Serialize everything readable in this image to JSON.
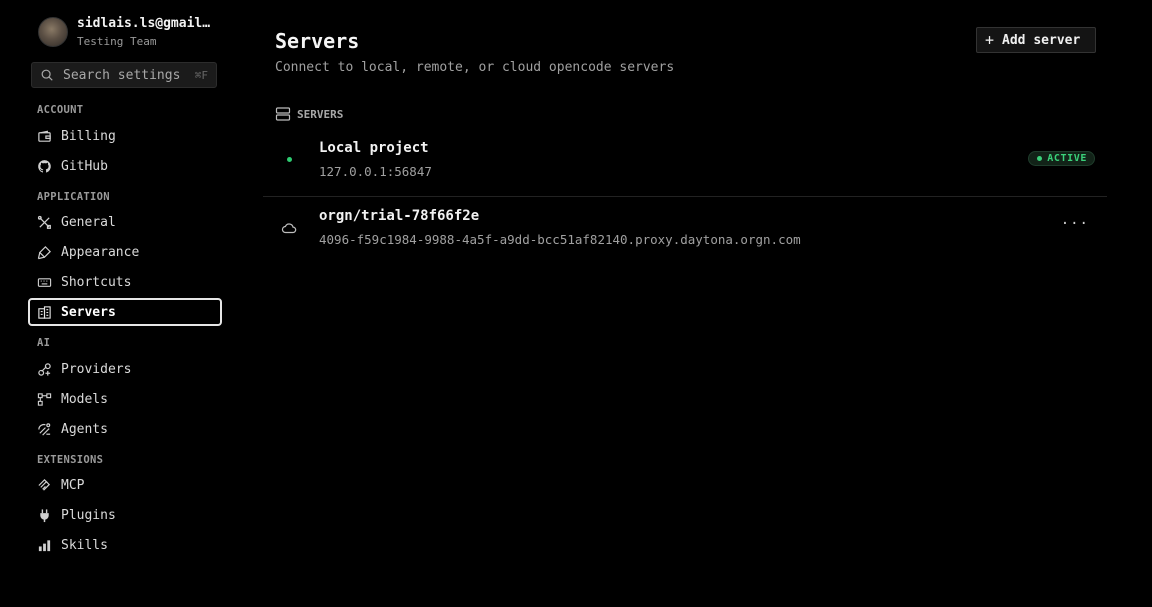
{
  "profile": {
    "email": "sidlais.ls@gmail.com",
    "team": "Testing Team"
  },
  "search": {
    "label": "Search settings",
    "shortcut": "⌘F"
  },
  "sections": {
    "account": "ACCOUNT",
    "application": "APPLICATION",
    "ai": "AI",
    "extensions": "EXTENSIONS"
  },
  "nav": {
    "billing": "Billing",
    "github": "GitHub",
    "general": "General",
    "appearance": "Appearance",
    "shortcuts": "Shortcuts",
    "servers": "Servers",
    "providers": "Providers",
    "models": "Models",
    "agents": "Agents",
    "mcp": "MCP",
    "plugins": "Plugins",
    "skills": "Skills"
  },
  "active_nav": "servers",
  "main": {
    "title": "Servers",
    "subtitle": "Connect to local, remote, or cloud opencode servers",
    "add_button": "Add server",
    "section_label": "SERVERS"
  },
  "servers": [
    {
      "name": "Local project",
      "url": "127.0.0.1:56847",
      "status": "ACTIVE",
      "icon": "green-dot-icon"
    },
    {
      "name": "orgn/trial-78f66f2e",
      "url": "4096-f59c1984-9988-4a5f-a9dd-bcc51af82140.proxy.daytona.orgn.com",
      "icon": "cloud-icon"
    }
  ],
  "colors": {
    "background": "#000000",
    "accent_green": "#3ad17a",
    "active_border": "#e6e6e6"
  }
}
